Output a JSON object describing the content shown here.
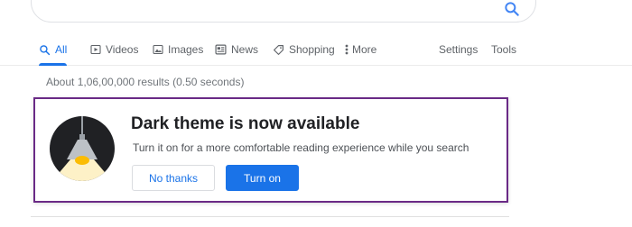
{
  "search": {
    "icon": "search-icon",
    "accent": "#1a73e8"
  },
  "tabs": [
    {
      "label": "All",
      "icon": "search-icon",
      "active": true
    },
    {
      "label": "Videos",
      "icon": "video-icon"
    },
    {
      "label": "Images",
      "icon": "image-icon"
    },
    {
      "label": "News",
      "icon": "news-icon"
    },
    {
      "label": "Shopping",
      "icon": "tag-icon"
    },
    {
      "label": "More",
      "icon": "more-vert-icon"
    }
  ],
  "tools": {
    "settings": "Settings",
    "tools": "Tools"
  },
  "results": {
    "stats": "About 1,06,00,000 results (0.50 seconds)"
  },
  "promo": {
    "title": "Dark theme is now available",
    "description": "Turn it on for a more comfortable reading experience while you search",
    "secondary_button": "No thanks",
    "primary_button": "Turn on",
    "illustration": "lamp-icon",
    "highlight_color": "#6a2a86"
  }
}
